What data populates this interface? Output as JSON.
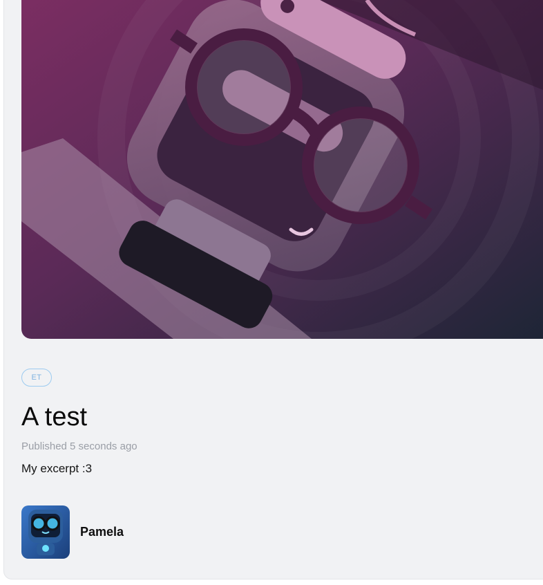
{
  "post": {
    "cover_image": "robot-with-glasses-illustration",
    "tag": "ET",
    "title": "A test",
    "published": "Published 5 seconds ago",
    "excerpt": "My excerpt :3",
    "author": {
      "name": "Pamela",
      "avatar": "robot-avatar"
    }
  },
  "colors": {
    "card_background": "#f1f2f4",
    "tag_border": "#9ccbf0",
    "tag_text": "#7fb2e0",
    "meta_text": "#9a9ea6"
  }
}
